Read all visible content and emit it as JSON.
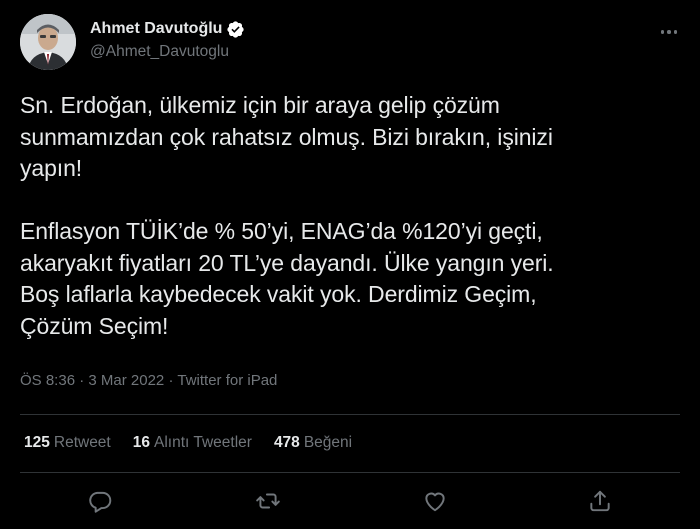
{
  "tweet": {
    "display_name": "Ahmet Davutoğlu",
    "handle": "@Ahmet_Davutoglu",
    "text": "Sn. Erdoğan, ülkemiz için bir araya gelip çözüm\nsunmamızdan çok rahatsız olmuş. Bizi bırakın, işinizi\nyapın!\n\nEnflasyon TÜİK’de % 50’yi, ENAG’da %120’yi geçti,\nakaryakıt fiyatları 20 TL’ye dayandı. Ülke yangın yeri.\nBoş laflarla kaybedecek vakit yok. Derdimiz Geçim,\nÇözüm Seçim!",
    "time": "ÖS 8:36",
    "separator": " · ",
    "date": "3 Mar 2022",
    "source": "Twitter for iPad"
  },
  "stats": {
    "retweet_count": "125",
    "retweet_label": "Retweet",
    "quote_count": "16",
    "quote_label": "Alıntı Tweetler",
    "like_count": "478",
    "like_label": "Beğeni"
  },
  "icons": {
    "verified": "verified-badge-icon",
    "more": "more-dots-icon",
    "reply": "reply-icon",
    "retweet": "retweet-icon",
    "like": "heart-icon",
    "share": "share-icon"
  },
  "colors": {
    "background": "#000000",
    "text": "#e7e9ea",
    "muted": "#71767b",
    "divider": "#2f3336",
    "verified": "#ffffff"
  }
}
